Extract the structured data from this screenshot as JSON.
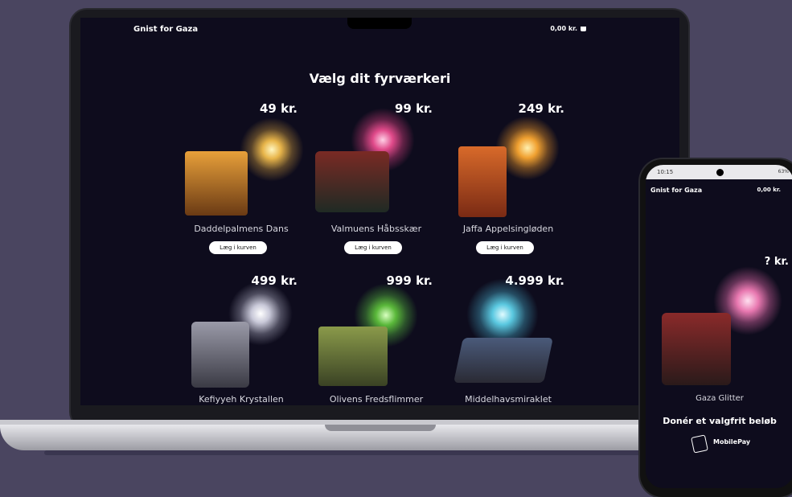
{
  "site": {
    "brand": "Gnist for Gaza",
    "cart_total": "0,00 kr."
  },
  "heading": "Vælg dit fyrværkeri",
  "add_label": "Læg i kurven",
  "products": [
    {
      "name": "Daddelpalmens Dans",
      "price": "49 kr."
    },
    {
      "name": "Valmuens Håbsskær",
      "price": "99 kr."
    },
    {
      "name": "Jaffa Appelsingløden",
      "price": "249 kr."
    },
    {
      "name": "Kefiyyeh Krystallen",
      "price": "499 kr."
    },
    {
      "name": "Olivens Fredsflimmer",
      "price": "999 kr."
    },
    {
      "name": "Middelhavsmiraklet",
      "price": "4.999 kr."
    }
  ],
  "phone": {
    "time": "10:15",
    "status": "63%",
    "brand": "Gnist for Gaza",
    "cart_total": "0,00 kr.",
    "price": "? kr.",
    "product_name": "Gaza Glitter",
    "donate_label": "Donér et valgfrit beløb",
    "pay_label": "MobilePay"
  },
  "colors": {
    "background": "#4a4560",
    "screen": "#0e0c1d",
    "accent": "#ffffff"
  }
}
